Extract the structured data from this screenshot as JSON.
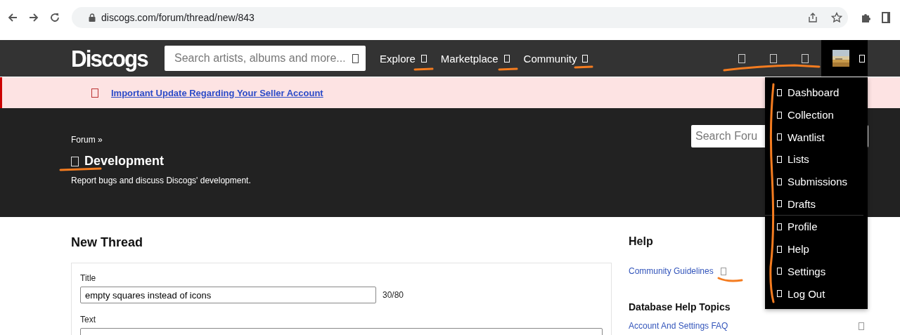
{
  "browser": {
    "url": "discogs.com/forum/thread/new/843"
  },
  "nav": {
    "logo": "Discogs",
    "search_placeholder": "Search artists, albums and more...",
    "menus": [
      {
        "label": "Explore"
      },
      {
        "label": "Marketplace"
      },
      {
        "label": "Community"
      }
    ],
    "user_menu": {
      "expanded": true,
      "groups": [
        [
          {
            "label": "Dashboard"
          },
          {
            "label": "Collection"
          },
          {
            "label": "Wantlist"
          },
          {
            "label": "Lists"
          },
          {
            "label": "Submissions"
          },
          {
            "label": "Drafts"
          }
        ],
        [
          {
            "label": "Profile"
          },
          {
            "label": "Help"
          },
          {
            "label": "Settings"
          },
          {
            "label": "Log Out"
          }
        ]
      ]
    }
  },
  "banner": {
    "link": "Important Update Regarding Your Seller Account"
  },
  "header": {
    "breadcrumb": "Forum »",
    "title": "Development",
    "description": "Report bugs and discuss Discogs' development.",
    "search_placeholder": "Search Foru"
  },
  "form": {
    "heading": "New Thread",
    "fields": [
      {
        "label": "Title",
        "value": "empty squares instead of icons",
        "counter": "30/80"
      },
      {
        "label": "Text"
      }
    ]
  },
  "sidebar": {
    "help_heading": "Help",
    "help_links": [
      {
        "label": "Community Guidelines"
      }
    ],
    "topics_heading": "Database Help Topics",
    "topics": [
      {
        "label": "Account And Settings FAQ"
      }
    ]
  }
}
